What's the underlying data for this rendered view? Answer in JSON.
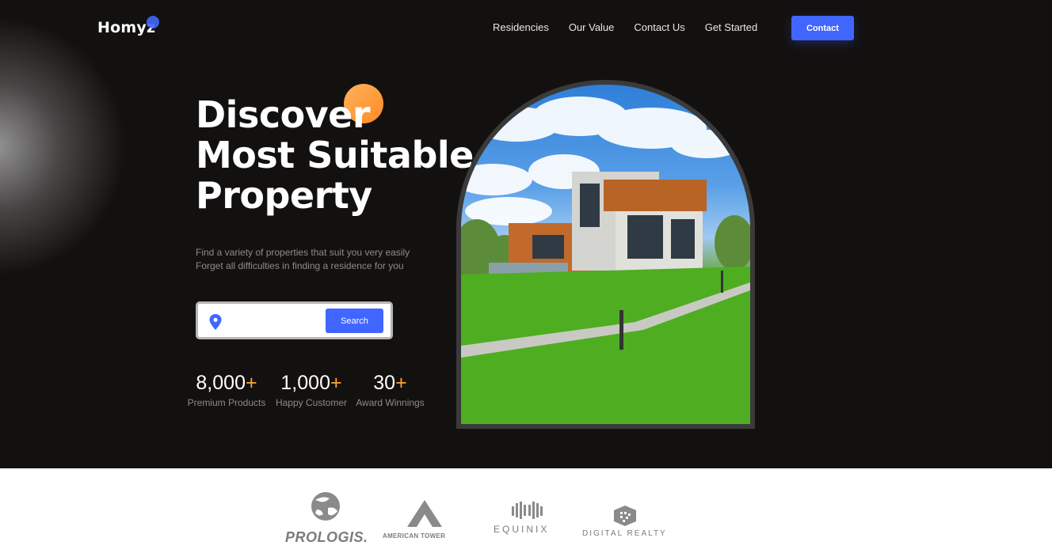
{
  "header": {
    "logo": "Homyz",
    "nav": [
      "Residencies",
      "Our Value",
      "Contact Us",
      "Get Started"
    ],
    "contact_label": "Contact"
  },
  "hero": {
    "headline": [
      "Discover",
      "Most Suitable",
      "Property"
    ],
    "subtext": [
      "Find a variety of properties that suit you very easily",
      "Forget all difficulties in finding a residence for you"
    ],
    "search": {
      "placeholder": "",
      "button_label": "Search"
    },
    "stats": [
      {
        "value": "8,000",
        "plus": "+",
        "label": "Premium Products"
      },
      {
        "value": "1,000",
        "plus": "+",
        "label": "Happy Customer"
      },
      {
        "value": "30",
        "plus": "+",
        "label": "Award Winnings"
      }
    ]
  },
  "brands": {
    "items": [
      "PROLOGIS.",
      "AMERICAN TOWER",
      "EQUINIX",
      "DIGITAL REALTY"
    ]
  },
  "colors": {
    "accent_blue": "#4066ff",
    "accent_orange": "#ffa433",
    "hero_bg": "#131110"
  },
  "icons": {
    "location": "map-pin-icon"
  }
}
